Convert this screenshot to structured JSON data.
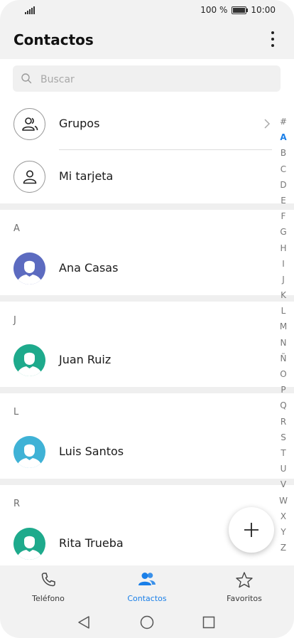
{
  "status_bar": {
    "battery_percent": "100 %",
    "time": "10:00"
  },
  "header": {
    "title": "Contactos"
  },
  "search": {
    "placeholder": "Buscar"
  },
  "special_rows": [
    {
      "label": "Grupos"
    },
    {
      "label": "Mi tarjeta"
    }
  ],
  "sections": [
    {
      "letter": "A",
      "contact": "Ana Casas",
      "avatar_color": "#5c6bc0"
    },
    {
      "letter": "J",
      "contact": "Juan Ruiz",
      "avatar_color": "#1eaa8c"
    },
    {
      "letter": "L",
      "contact": "Luis Santos",
      "avatar_color": "#3fb2d6"
    },
    {
      "letter": "R",
      "contact": "Rita Trueba",
      "avatar_color": "#1eaa8c"
    }
  ],
  "index_letters": [
    "#",
    "A",
    "B",
    "C",
    "D",
    "E",
    "F",
    "G",
    "H",
    "I",
    "J",
    "K",
    "L",
    "M",
    "N",
    "Ñ",
    "O",
    "P",
    "Q",
    "R",
    "S",
    "T",
    "U",
    "V",
    "W",
    "X",
    "Y",
    "Z"
  ],
  "index_active": "A",
  "bottom_nav": {
    "phone": "Teléfono",
    "contacts": "Contactos",
    "favorites": "Favoritos",
    "active": "contacts"
  },
  "colors": {
    "accent": "#1a7fe8",
    "bar_bg": "#f2f2f2"
  }
}
